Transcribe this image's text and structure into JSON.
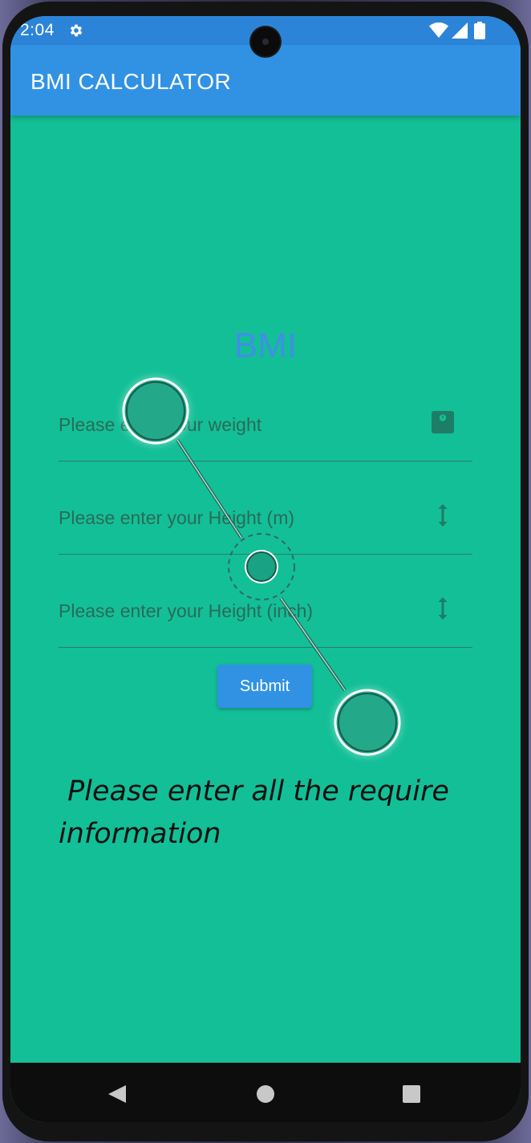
{
  "status_bar": {
    "time": "2:04",
    "icons": [
      "gear-icon",
      "wifi-icon",
      "signal-icon",
      "battery-icon"
    ]
  },
  "app_bar": {
    "title": "BMI CALCULATOR"
  },
  "main": {
    "heading": "BMI",
    "weight_field": {
      "placeholder": "Please enter your weight",
      "value": "",
      "icon": "scale-icon"
    },
    "height_m_field": {
      "placeholder": "Please enter your Height (m)",
      "value": "",
      "icon": "vertical-arrows-icon"
    },
    "height_inch_field": {
      "placeholder": "Please enter your Height (inch)",
      "value": "",
      "icon": "vertical-arrows-icon"
    },
    "submit_label": "Submit",
    "message": " Please enter all the require information"
  },
  "nav_bar": {
    "icons": [
      "back-icon",
      "home-icon",
      "recents-icon"
    ]
  },
  "colors": {
    "screen_background": "#13bf97",
    "app_bar": "#3192e4",
    "status_bar": "#2c84d8",
    "heading": "#3f8fe6",
    "button": "#3192e4"
  }
}
